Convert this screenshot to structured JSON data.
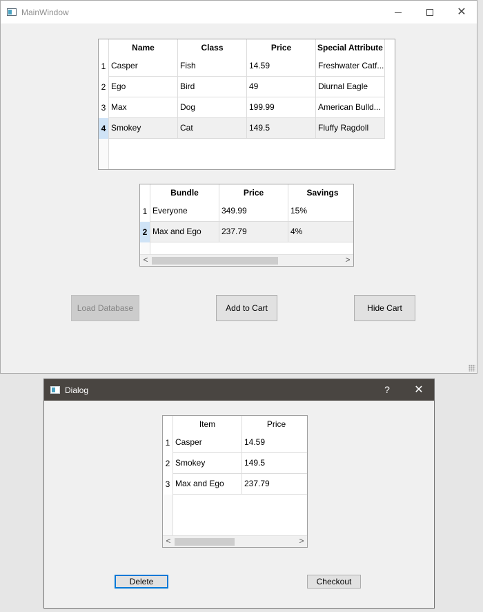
{
  "main_window": {
    "title": "MainWindow",
    "pets_table": {
      "headers": [
        "Name",
        "Class",
        "Price",
        "Special Attribute"
      ],
      "rows": [
        {
          "num": "1",
          "cells": [
            "Casper",
            "Fish",
            "14.59",
            "Freshwater Catf..."
          ]
        },
        {
          "num": "2",
          "cells": [
            "Ego",
            "Bird",
            "49",
            "Diurnal Eagle"
          ]
        },
        {
          "num": "3",
          "cells": [
            "Max",
            "Dog",
            "199.99",
            "American Bulld..."
          ]
        },
        {
          "num": "4",
          "cells": [
            "Smokey",
            "Cat",
            "149.5",
            "Fluffy Ragdoll"
          ]
        }
      ],
      "selected_row": 4
    },
    "bundles_table": {
      "headers": [
        "Bundle",
        "Price",
        "Savings"
      ],
      "rows": [
        {
          "num": "1",
          "cells": [
            "Everyone",
            "349.99",
            "15%"
          ]
        },
        {
          "num": "2",
          "cells": [
            "Max and Ego",
            "237.79",
            "4%"
          ]
        }
      ],
      "selected_row": 2
    },
    "buttons": {
      "load_database": "Load Database",
      "add_to_cart": "Add to Cart",
      "hide_cart": "Hide Cart"
    }
  },
  "dialog": {
    "title": "Dialog",
    "help_symbol": "?",
    "cart_table": {
      "headers": [
        "Item",
        "Price"
      ],
      "rows": [
        {
          "num": "1",
          "cells": [
            "Casper",
            "14.59"
          ]
        },
        {
          "num": "2",
          "cells": [
            "Smokey",
            "149.5"
          ]
        },
        {
          "num": "3",
          "cells": [
            "Max and Ego",
            "237.79"
          ]
        }
      ]
    },
    "buttons": {
      "delete": "Delete",
      "checkout": "Checkout"
    }
  },
  "scroll_arrows": {
    "left": "<",
    "right": ">"
  }
}
